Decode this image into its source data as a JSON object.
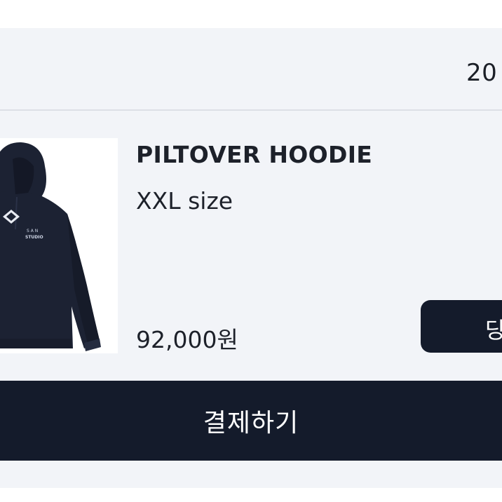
{
  "order": {
    "date_partial": "20"
  },
  "product": {
    "image_name": "navy hoodie with SAN STUDIO logo",
    "name": "PILTOVER HOODIE",
    "option": "XXL size",
    "price": "92,000원"
  },
  "actions": {
    "side_button_label_partial": "당",
    "pay_button_label": "결제하기"
  },
  "colors": {
    "card_background": "#f2f4f8",
    "button_background": "#141b2b",
    "text_primary": "#1d212a",
    "hoodie_navy": "#1c2233"
  }
}
